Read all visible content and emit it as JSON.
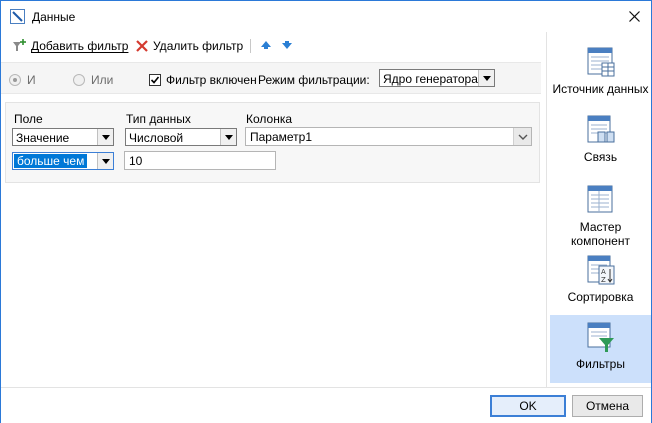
{
  "window": {
    "title": "Данные"
  },
  "toolbar": {
    "add_filter": "Добавить фильтр",
    "delete_filter": "Удалить фильтр"
  },
  "options": {
    "radio_and": "И",
    "radio_or": "Или",
    "filter_enabled": "Фильтр включен",
    "mode_label": "Режим фильтрации:",
    "mode_value": "Ядро генератора"
  },
  "filter": {
    "headers": {
      "field": "Поле",
      "data_type": "Тип данных",
      "column": "Колонка"
    },
    "field_value": "Значение",
    "data_type_value": "Числовой",
    "column_value": "Параметр1",
    "condition_value": "больше чем",
    "operand_value": "10"
  },
  "sidebar": {
    "items": [
      {
        "label": "Источник данных",
        "icon": "table-icon"
      },
      {
        "label": "Связь",
        "icon": "link-tables-icon"
      },
      {
        "label": "Мастер компонент",
        "icon": "wizard-icon"
      },
      {
        "label": "Сортировка",
        "icon": "sort-az-icon"
      },
      {
        "label": "Фильтры",
        "icon": "filter-funnel-icon"
      }
    ]
  },
  "buttons": {
    "ok": "OK",
    "cancel": "Отмена"
  },
  "colors": {
    "accent": "#2b79d8",
    "active_item": "#cce0fb",
    "selection": "#0078d7"
  }
}
